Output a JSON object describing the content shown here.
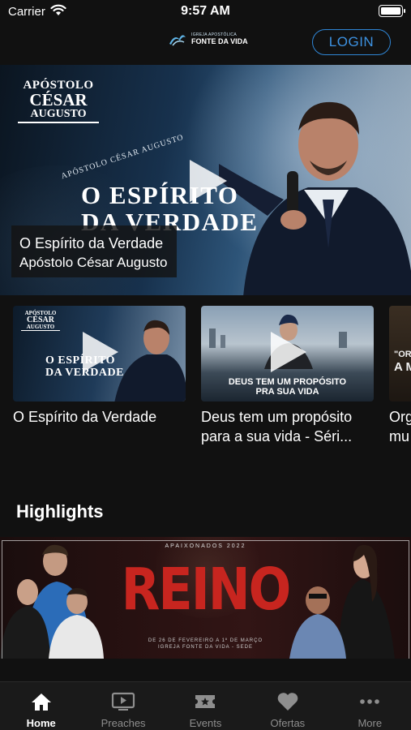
{
  "status_bar": {
    "carrier": "Carrier",
    "time": "9:57 AM"
  },
  "header": {
    "logo_small": "IGREJA APOSTÓLICA",
    "logo_big": "FONTE DA VIDA",
    "login_label": "LOGIN"
  },
  "hero": {
    "poster_name_line1": "APÓSTOLO",
    "poster_name_line2": "CÉSAR",
    "poster_name_line3": "AUGUSTO",
    "poster_arc_text": "APÓSTOLO CÉSAR AUGUSTO",
    "poster_title_line1": "O ESPÍRITO",
    "poster_title_line2": "DA VERDADE",
    "caption_title": "O Espírito da Verdade",
    "caption_subtitle": "Apóstolo César Augusto"
  },
  "carousel": {
    "items": [
      {
        "title": "O Espírito da Verdade",
        "thumb_line1": "APÓSTOLO",
        "thumb_line2": "CÉSAR",
        "thumb_line3": "AUGUSTO",
        "thumb_title1": "O ESPÍRITO",
        "thumb_title2": "DA VERDADE"
      },
      {
        "title": "Deus tem um propósito para a sua vida - Séri...",
        "thumb_title1": "DEUS TEM UM PROPÓSITO",
        "thumb_title2": "PRA SUA VIDA"
      },
      {
        "title": "Org mu",
        "thumb_title1": "\"ORG",
        "thumb_title2": "A M"
      }
    ]
  },
  "highlights": {
    "section_title": "Highlights",
    "banner": {
      "subtag": "APAIXONADOS 2022",
      "title": "REINO",
      "dates_line1": "DE 26 DE FEVEREIRO A 1º DE MARÇO",
      "dates_line2": "IGREJA FONTE DA VIDA - SEDE"
    }
  },
  "tabbar": {
    "items": [
      {
        "label": "Home",
        "icon": "home-icon",
        "active": true
      },
      {
        "label": "Preaches",
        "icon": "video-icon",
        "active": false
      },
      {
        "label": "Events",
        "icon": "ticket-icon",
        "active": false
      },
      {
        "label": "Ofertas",
        "icon": "heart-icon",
        "active": false
      },
      {
        "label": "More",
        "icon": "more-icon",
        "active": false
      }
    ]
  },
  "colors": {
    "accent": "#2f86d6",
    "background": "#111111",
    "tabbar": "#1a1a1a",
    "reino_red": "#c7251f"
  }
}
